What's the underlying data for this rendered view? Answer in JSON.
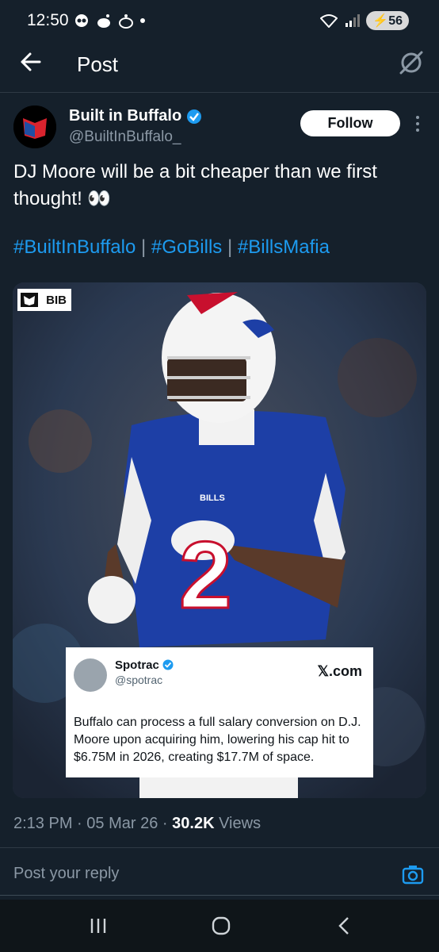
{
  "status_bar": {
    "time": "12:50",
    "battery": "56"
  },
  "header": {
    "title": "Post",
    "back_icon": "arrow-left-icon",
    "grok_icon": "grok-icon"
  },
  "post": {
    "author_name": "Built in Buffalo",
    "author_handle": "@BuiltInBuffalo_",
    "follow_label": "Follow",
    "text": "DJ Moore will be a bit cheaper than we first thought! 👀",
    "hashtags": [
      "#BuiltInBuffalo",
      "#GoBills",
      "#BillsMafia"
    ],
    "hashtag_separator": "|",
    "media": {
      "logo_text": "BIB",
      "jersey_text": "BILLS",
      "jersey_number": "2",
      "quote": {
        "name": "Spotrac",
        "handle": "@spotrac",
        "source": "𝕏.com",
        "text": "Buffalo can process a full salary conversion on D.J. Moore upon acquiring him, lowering his cap hit to $6.75M in 2026, creating $17.7M of space."
      }
    },
    "time": "2:13 PM",
    "date": "05 Mar 26",
    "views_count": "30.2K",
    "views_label": "Views",
    "dot": "·"
  },
  "reply": {
    "placeholder": "Post your reply"
  },
  "colors": {
    "background": "#15202b",
    "accent": "#1d9bf0",
    "verified": "#1d9bf0"
  }
}
